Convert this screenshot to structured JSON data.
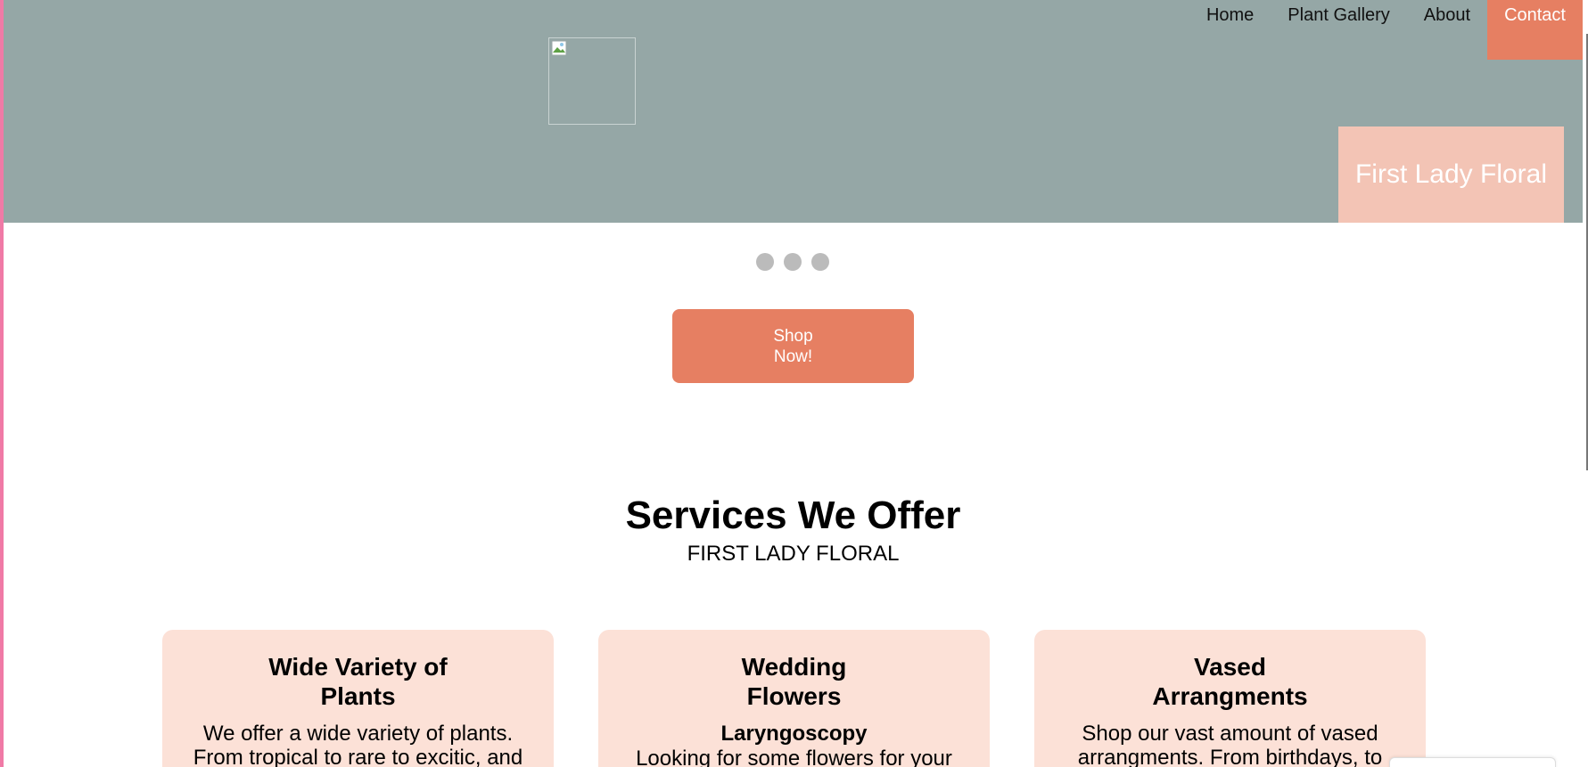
{
  "nav": {
    "items": [
      {
        "label": "Home",
        "active": false
      },
      {
        "label": "Plant Gallery",
        "active": false
      },
      {
        "label": "About",
        "active": false
      },
      {
        "label": "Contact",
        "active": true
      }
    ]
  },
  "hero": {
    "brand": "First Lady Floral",
    "image_icon": "broken-image-icon"
  },
  "carousel": {
    "dot_count": 3
  },
  "cta": {
    "label": "Shop Now!"
  },
  "services": {
    "title": "Services We Offer",
    "subtitle": "FIRST LADY FLORAL",
    "cards": [
      {
        "title": "Wide Variety of Plants",
        "subtitle": "",
        "body": "We offer a wide variety of plants. From tropical to rare to excitic, and"
      },
      {
        "title": "Wedding Flowers",
        "subtitle": "Laryngoscopy",
        "body": "Looking for some flowers for your"
      },
      {
        "title": "Vased Arrangments",
        "subtitle": "",
        "body": "Shop our vast amount of vased arrangments. From birthdays, to"
      }
    ]
  },
  "colors": {
    "hero_bg": "#95a7a6",
    "accent": "#e67f62",
    "brand_box": "#f3c4b5",
    "card_bg": "#fce1d7",
    "dot": "#bbbbbb",
    "left_edge": "#f07aa6"
  }
}
